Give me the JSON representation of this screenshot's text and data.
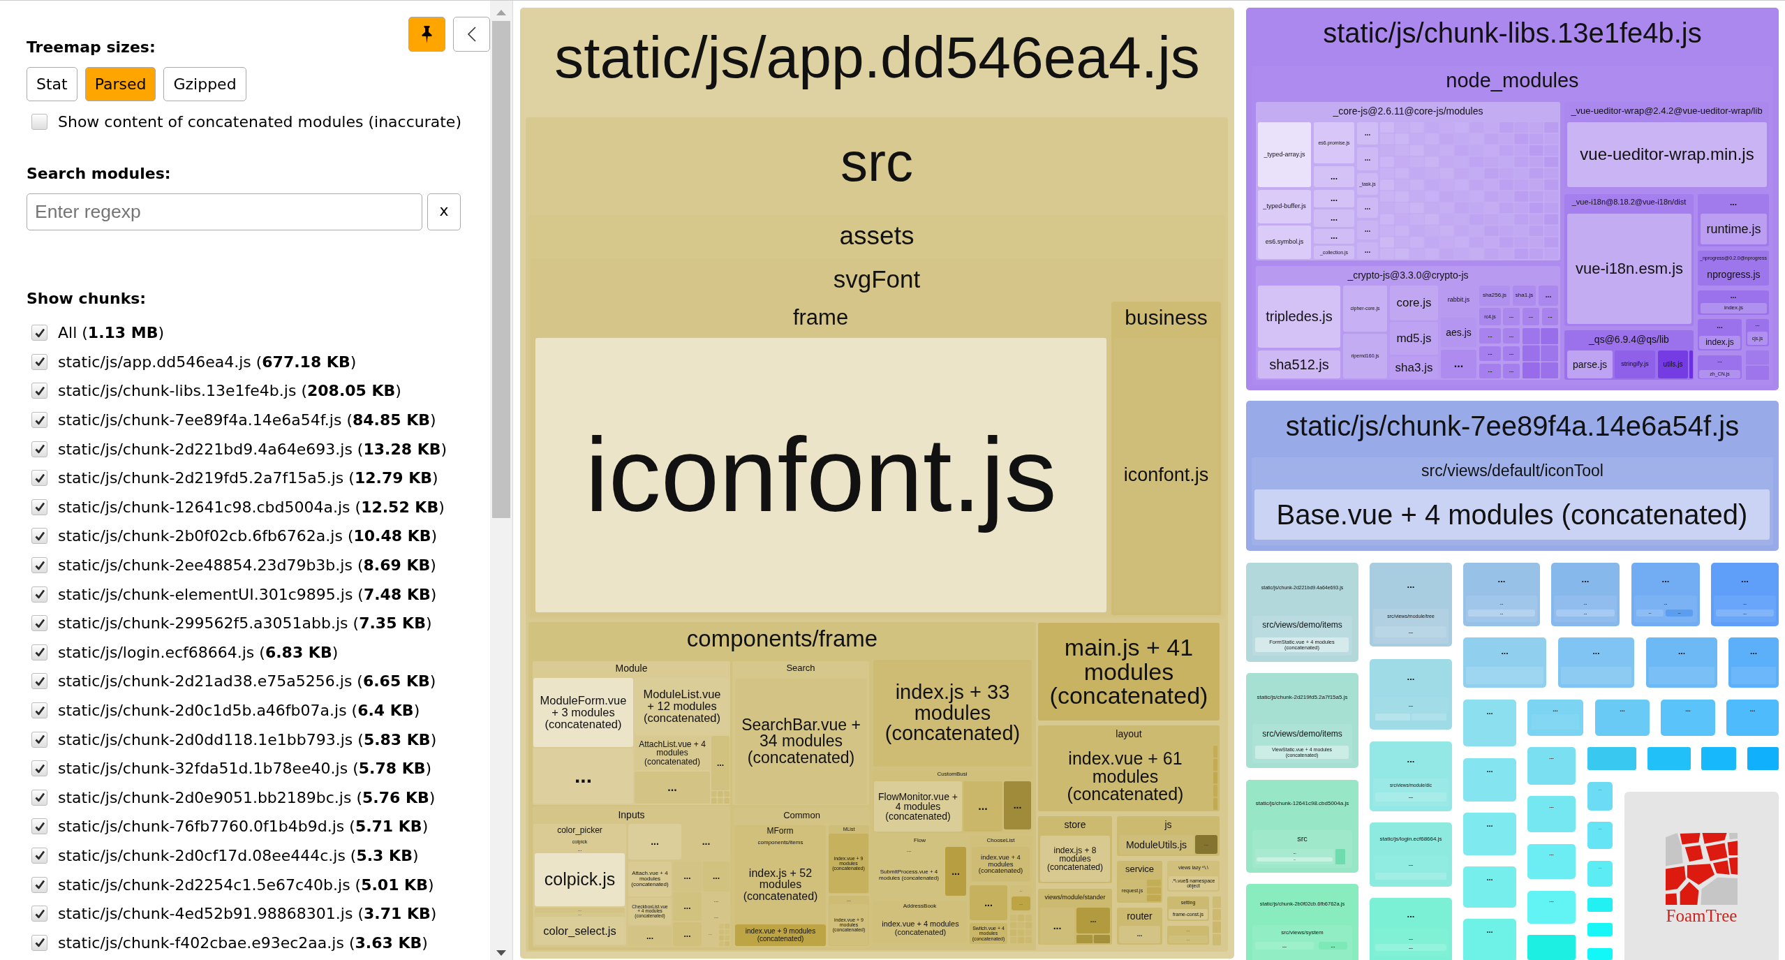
{
  "sidebar": {
    "pinned": true,
    "sizes_title": "Treemap sizes:",
    "size_modes": [
      {
        "label": "Stat",
        "selected": false
      },
      {
        "label": "Parsed",
        "selected": true
      },
      {
        "label": "Gzipped",
        "selected": false
      }
    ],
    "concatenated": {
      "label": "Show content of concatenated modules (inaccurate)",
      "checked": false
    },
    "search_title": "Search modules:",
    "search": {
      "placeholder": "Enter regexp",
      "clear_label": "x"
    },
    "chunks_title": "Show chunks:",
    "chunks": [
      {
        "label": "All (**1.13 MB**)",
        "checked": true
      },
      {
        "label": "static/js/app.dd546ea4.js (**677.18 KB**)",
        "checked": true
      },
      {
        "label": "static/js/chunk-libs.13e1fe4b.js (**208.05 KB**)",
        "checked": true
      },
      {
        "label": "static/js/chunk-7ee89f4a.14e6a54f.js (**84.85 KB**)",
        "checked": true
      },
      {
        "label": "static/js/chunk-2d221bd9.4a64e693.js (**13.28 KB**)",
        "checked": true
      },
      {
        "label": "static/js/chunk-2d219fd5.2a7f15a5.js (**12.79 KB**)",
        "checked": true
      },
      {
        "label": "static/js/chunk-12641c98.cbd5004a.js (**12.52 KB**)",
        "checked": true
      },
      {
        "label": "static/js/chunk-2b0f02cb.6fb6762a.js (**10.48 KB**)",
        "checked": true
      },
      {
        "label": "static/js/chunk-2ee48854.23d79b3b.js (**8.69 KB**)",
        "checked": true
      },
      {
        "label": "static/js/chunk-elementUI.301c9895.js (**7.48 KB**)",
        "checked": true
      },
      {
        "label": "static/js/chunk-299562f5.a3051abb.js (**7.35 KB**)",
        "checked": true
      },
      {
        "label": "static/js/login.ecf68664.js (**6.83 KB**)",
        "checked": true
      },
      {
        "label": "static/js/chunk-2d21ad38.e75a5256.js (**6.65 KB**)",
        "checked": true
      },
      {
        "label": "static/js/chunk-2d0c1d5b.a46fb07a.js (**6.4 KB**)",
        "checked": true
      },
      {
        "label": "static/js/chunk-2d0dd118.1e1bb793.js (**5.83 KB**)",
        "checked": true
      },
      {
        "label": "static/js/chunk-32fda51d.1b78ee40.js (**5.78 KB**)",
        "checked": true
      },
      {
        "label": "static/js/chunk-2d0e9051.bb2189bc.js (**5.76 KB**)",
        "checked": true
      },
      {
        "label": "static/js/chunk-76fb7760.0f1b4b9d.js (**5.71 KB**)",
        "checked": true
      },
      {
        "label": "static/js/chunk-2d0cf17d.08ee444c.js (**5.3 KB**)",
        "checked": true
      },
      {
        "label": "static/js/chunk-2d2254c1.5e67c40b.js (**5.01 KB**)",
        "checked": true
      },
      {
        "label": "static/js/chunk-4ed52b91.98868301.js (**3.71 KB**)",
        "checked": true
      },
      {
        "label": "static/js/chunk-f402cbae.e93ec2aa.js (**3.63 KB**)",
        "checked": true
      }
    ]
  },
  "treemap": {
    "chunks": [
      {
        "label": "static/js/app.dd546ea4.js",
        "color": "#ded2a2",
        "children": [
          {
            "label": "src",
            "children": [
              {
                "label": "assets",
                "children": [
                  {
                    "label": "svgFont",
                    "children": [
                      {
                        "label": "frame",
                        "children": [
                          {
                            "label": "iconfont.js"
                          }
                        ]
                      },
                      {
                        "label": "business",
                        "children": [
                          {
                            "label": "iconfont.js"
                          }
                        ]
                      }
                    ]
                  }
                ]
              },
              {
                "label": "components/frame",
                "children": [
                  {
                    "label": "Module",
                    "children": [
                      {
                        "label": "ModuleForm.vue + 3 modules (concatenated)"
                      },
                      {
                        "label": "..."
                      },
                      {
                        "label": "ModuleList.vue + 12 modules (concatenated)"
                      },
                      {
                        "label": "AttachList.vue + 4 modules (concatenated)"
                      },
                      {
                        "label": "..."
                      },
                      {
                        "label": "..."
                      }
                    ]
                  },
                  {
                    "label": "Search",
                    "children": [
                      {
                        "label": "SearchBar.vue + 34 modules (concatenated)"
                      }
                    ]
                  },
                  {
                    "label": "Inputs",
                    "children": [
                      {
                        "label": "color_picker",
                        "children": [
                          {
                            "label": "colpick",
                            "children": [
                              {
                                "label": "...",
                                "children": [
                                  {
                                    "label": "colpick.js"
                                  }
                                ]
                              }
                            ]
                          },
                          {
                            "label": "...",
                            "children": [
                              {
                                "label": "...",
                                "children": [
                                  {
                                    "label": "color_select.js"
                                  }
                                ]
                              }
                            ]
                          }
                        ]
                      },
                      {
                        "label": "..."
                      },
                      {
                        "label": "..."
                      },
                      {
                        "label": "Attach.vue + 4 modules (concatenated)"
                      },
                      {
                        "label": "CheckboxList.vue + 4 modules (concatenated)"
                      },
                      {
                        "label": "..."
                      },
                      {
                        "label": "..."
                      },
                      {
                        "label": "..."
                      },
                      {
                        "label": "..."
                      },
                      {
                        "label": "..."
                      },
                      {
                        "label": "..."
                      },
                      {
                        "label": "..."
                      },
                      {
                        "label": "..."
                      }
                    ]
                  },
                  {
                    "label": "Common",
                    "children": [
                      {
                        "label": "MForm",
                        "children": [
                          {
                            "label": "components/items",
                            "children": [
                              {
                                "label": "index.js + 52 modules (concatenated)"
                              }
                            ]
                          },
                          {
                            "label": "index.vue + 9 modules (concatenated)"
                          }
                        ]
                      },
                      {
                        "label": "MList",
                        "children": [
                          {
                            "label": "index.vue + 9 modules (concatenated)"
                          }
                        ]
                      },
                      {
                        "label": "...",
                        "children": [
                          {
                            "label": "index.vue + 9 modules (concatenated)"
                          }
                        ]
                      }
                    ]
                  },
                  {
                    "label": "index.js + 33 modules (concatenated)"
                  },
                  {
                    "label": "CustomBusi",
                    "children": [
                      {
                        "label": "FlowMonitor.vue + 4 modules (concatenated)"
                      },
                      {
                        "label": "..."
                      },
                      {
                        "label": "..."
                      }
                    ]
                  },
                  {
                    "label": "Flow",
                    "children": [
                      {
                        "label": "...",
                        "children": [
                          {
                            "label": "SubmitProcess.vue + 4 modules (concatenated)"
                          }
                        ]
                      },
                      {
                        "label": "..."
                      }
                    ]
                  },
                  {
                    "label": "ChooseList",
                    "children": [
                      {
                        "label": "index.vue + 4 modules (concatenated)"
                      }
                    ]
                  },
                  {
                    "label": "..."
                  },
                  {
                    "label": "...",
                    "children": [
                      {
                        "label": "..."
                      }
                    ]
                  },
                  {
                    "label": "Switch.vue + 4 modules (concatenated)"
                  },
                  {
                    "label": "AddressBook",
                    "children": [
                      {
                        "label": "index.vue + 4 modules (concatenated)"
                      }
                    ]
                  }
                ]
              },
              {
                "label": "main.js + 41 modules (concatenated)"
              },
              {
                "label": "layout",
                "children": [
                  {
                    "label": "index.vue + 61 modules (concatenated)"
                  }
                ]
              },
              {
                "label": "store",
                "children": [
                  {
                    "label": "index.js + 8 modules (concatenated)"
                  }
                ]
              },
              {
                "label": "js",
                "children": [
                  {
                    "label": "ModuleUtils.js"
                  },
                  {
                    "label": "..."
                  }
                ]
              },
              {
                "label": "views/module/stander",
                "children": [
                  {
                    "label": "..."
                  },
                  {
                    "label": "..."
                  }
                ]
              },
              {
                "label": "service",
                "children": [
                  {
                    "label": "request.js"
                  }
                ]
              },
              {
                "label": "views lazy ^\\.\\",
                "children": [
                  {
                    "label": ".*\\.vue$ namespace object"
                  }
                ]
              },
              {
                "label": "setting",
                "children": [
                  {
                    "label": "frame-const.js"
                  }
                ]
              },
              {
                "label": "router",
                "children": [
                  {
                    "label": "..."
                  }
                ]
              },
              {
                "label": "...",
                "children": [
                  {
                    "label": "..."
                  }
                ]
              }
            ]
          }
        ]
      },
      {
        "label": "static/js/chunk-libs.13e1fe4b.js",
        "color": "#ab88ee",
        "children": [
          {
            "label": "node_modules",
            "children": [
              {
                "label": "_core-js@2.6.11@core-js/modules",
                "children": [
                  {
                    "label": "_typed-array.js"
                  },
                  {
                    "label": "_typed-buffer.js"
                  },
                  {
                    "label": "es6.symbol.js"
                  },
                  {
                    "label": "es6.promise.js"
                  },
                  {
                    "label": "..."
                  },
                  {
                    "label": "..."
                  },
                  {
                    "label": "..."
                  },
                  {
                    "label": "..."
                  },
                  {
                    "label": "_collection.js"
                  },
                  {
                    "label": "..."
                  },
                  {
                    "label": "..."
                  },
                  {
                    "label": "_task.js"
                  },
                  {
                    "label": "..."
                  },
                  {
                    "label": "..."
                  },
                  {
                    "label": "..."
                  }
                ]
              },
              {
                "label": "_crypto-js@3.3.0@crypto-js",
                "children": [
                  {
                    "label": "tripledes.js"
                  },
                  {
                    "label": "sha512.js"
                  },
                  {
                    "label": "cipher-core.js"
                  },
                  {
                    "label": "ripemd160.js"
                  },
                  {
                    "label": "core.js"
                  },
                  {
                    "label": "md5.js"
                  },
                  {
                    "label": "sha3.js"
                  },
                  {
                    "label": "rabbit.js"
                  },
                  {
                    "label": "aes.js"
                  },
                  {
                    "label": "..."
                  },
                  {
                    "label": "sha256.js"
                  },
                  {
                    "label": "sha1.js"
                  },
                  {
                    "label": "..."
                  },
                  {
                    "label": "rc4.js"
                  },
                  {
                    "label": "..."
                  },
                  {
                    "label": "..."
                  },
                  {
                    "label": "..."
                  },
                  {
                    "label": "..."
                  },
                  {
                    "label": "..."
                  },
                  {
                    "label": "..."
                  },
                  {
                    "label": "..."
                  },
                  {
                    "label": "..."
                  },
                  {
                    "label": "..."
                  }
                ]
              },
              {
                "label": "_vue-ueditor-wrap@2.4.2@vue-ueditor-wrap/lib",
                "children": [
                  {
                    "label": "vue-ueditor-wrap.min.js"
                  }
                ]
              },
              {
                "label": "_vue-i18n@8.18.2@vue-i18n/dist",
                "children": [
                  {
                    "label": "vue-i18n.esm.js"
                  }
                ]
              },
              {
                "label": "...",
                "children": [
                  {
                    "label": "runtime.js"
                  }
                ]
              },
              {
                "label": "_nprogress@0.2.0@nprogress",
                "children": [
                  {
                    "label": "nprogress.js"
                  }
                ]
              },
              {
                "label": "...",
                "children": [
                  {
                    "label": "index.js"
                  }
                ]
              },
              {
                "label": "...",
                "children": [
                  {
                    "label": "index.js"
                  }
                ]
              },
              {
                "label": "...",
                "children": [
                  {
                    "label": "cjs.js"
                  }
                ]
              },
              {
                "label": "...",
                "children": [
                  {
                    "label": "zh_CN.js"
                  }
                ]
              },
              {
                "label": "_qs@6.9.4@qs/lib",
                "children": [
                  {
                    "label": "parse.js"
                  },
                  {
                    "label": "stringify.js"
                  },
                  {
                    "label": "utils.js"
                  }
                ]
              }
            ]
          }
        ]
      },
      {
        "label": "static/js/chunk-7ee89f4a.14e6a54f.js",
        "color": "#98aae7",
        "children": [
          {
            "label": "src/views/default/iconTool",
            "children": [
              {
                "label": "Base.vue + 4 modules (concatenated)"
              }
            ]
          }
        ]
      },
      {
        "label": "static/js/chunk-2d221bd9.4a64e693.js",
        "color": "#b3d8dc",
        "children": [
          {
            "label": "src/views/demo/items",
            "children": [
              {
                "label": "FormStatic.vue + 4 modules (concatenated)"
              }
            ]
          }
        ]
      },
      {
        "label": "static/js/chunk-2d219fd5.2a7f15a5.js",
        "color": "#a5e0d2",
        "children": [
          {
            "label": "src/views/demo/items",
            "children": [
              {
                "label": "ViewStatic.vue + 4 modules (concatenated)"
              }
            ]
          }
        ]
      },
      {
        "label": "static/js/chunk-12641c98.cbd5004a.js",
        "color": "#97e6c6",
        "children": [
          {
            "label": "src",
            "children": [
              {
                "label": "...",
                "children": [
                  {
                    "label": "..."
                  }
                ]
              }
            ]
          }
        ]
      },
      {
        "label": "static/js/chunk-2b0f02cb.6fb6762a.js",
        "color": "#88ecbe",
        "children": [
          {
            "label": "src/views/system",
            "children": [
              {
                "label": "..."
              },
              {
                "label": "..."
              }
            ]
          }
        ]
      },
      {
        "label": "...",
        "color": "#a9cde0",
        "children": [
          {
            "label": "src/views/module/tree",
            "children": [
              {
                "label": "..."
              }
            ]
          }
        ]
      },
      {
        "label": "...",
        "color": "#9edbe6",
        "children": [
          {
            "label": "..."
          }
        ]
      },
      {
        "label": "...",
        "color": "#93e7e4",
        "children": [
          {
            "label": "src/views/module/dic",
            "children": [
              {
                "label": "..."
              }
            ]
          }
        ]
      },
      {
        "label": "static/js/login.ecf68664.js",
        "color": "#8ceadf",
        "children": [
          {
            "label": "..."
          }
        ]
      },
      {
        "label": "...",
        "color": "#7cf0d5",
        "children": [
          {
            "label": "...",
            "children": [
              {
                "label": "..."
              }
            ]
          }
        ]
      },
      {
        "label": "...",
        "color": "#98c1e7",
        "children": [
          {
            "label": "...",
            "children": [
              {
                "label": "..."
              }
            ]
          }
        ]
      },
      {
        "label": "...",
        "color": "#87b8ec",
        "children": [
          {
            "label": "...",
            "children": [
              {
                "label": "..."
              }
            ]
          }
        ]
      },
      {
        "label": "...",
        "color": "#72acf2",
        "children": [
          {
            "label": "...",
            "children": [
              {
                "label": "..."
              },
              {
                "label": "..."
              }
            ]
          }
        ]
      },
      {
        "label": "...",
        "color": "#5f9ff9",
        "children": [
          {
            "label": "...",
            "children": [
              {
                "label": "..."
              }
            ]
          }
        ]
      },
      {
        "label": "...",
        "color": "#91cfee"
      },
      {
        "label": "...",
        "color": "#7fc4f2"
      },
      {
        "label": "...",
        "color": "#6cb9f6"
      },
      {
        "label": "...",
        "color": "#5cb0f9"
      },
      {
        "label": "...",
        "color": "#8cdfee"
      },
      {
        "label": "...",
        "color": "#7bd4f1"
      },
      {
        "label": "...",
        "color": "#6acaf6"
      },
      {
        "label": "...",
        "color": "#5ac3f9"
      },
      {
        "label": "...",
        "color": "#4ebcfc"
      },
      {
        "label": "...",
        "color": "#84e5f0"
      },
      {
        "label": "...",
        "color": "#7eeaf0"
      },
      {
        "label": "...",
        "color": "#76eeeb"
      },
      {
        "label": "...",
        "color": "#6ef1e6"
      },
      {
        "label": "...",
        "color": "#7bdff2"
      },
      {
        "label": "...",
        "color": "#74e7f1"
      },
      {
        "label": "...",
        "color": "#6cedf4"
      },
      {
        "label": "...",
        "color": "#62f3f4"
      },
      {
        "label": "...",
        "color": "#6cdcf4"
      },
      {
        "label": "...",
        "color": "#64e4f4"
      },
      {
        "label": "...",
        "color": "#5cecf4"
      }
    ],
    "branding": "FoamTree"
  }
}
